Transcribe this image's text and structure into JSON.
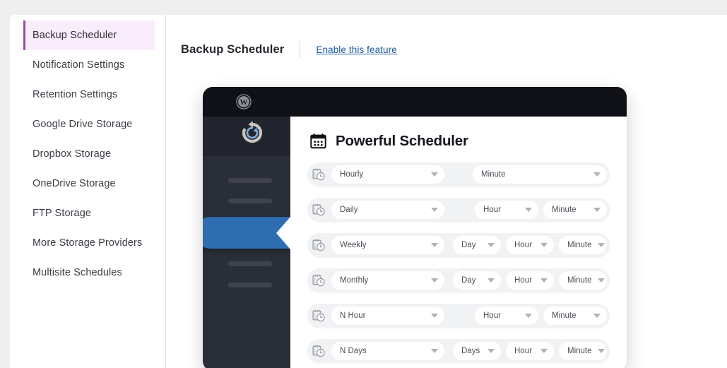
{
  "sidebar": {
    "items": [
      {
        "label": "Backup Scheduler",
        "active": true
      },
      {
        "label": "Notification Settings",
        "active": false
      },
      {
        "label": "Retention Settings",
        "active": false
      },
      {
        "label": "Google Drive Storage",
        "active": false
      },
      {
        "label": "Dropbox Storage",
        "active": false
      },
      {
        "label": "OneDrive Storage",
        "active": false
      },
      {
        "label": "FTP Storage",
        "active": false
      },
      {
        "label": "More Storage Providers",
        "active": false
      },
      {
        "label": "Multisite Schedules",
        "active": false
      }
    ]
  },
  "header": {
    "title": "Backup Scheduler",
    "enable_link": "Enable this feature"
  },
  "mockup": {
    "logo_icon": "wordpress-icon",
    "active_item_icon": "restore-refresh-icon",
    "title": "Powerful Scheduler",
    "title_icon": "calendar-icon",
    "row_icon": "calendar-clock-icon",
    "rows": [
      {
        "frequency": "Hourly",
        "slots": [
          "Minute"
        ]
      },
      {
        "frequency": "Daily",
        "slots": [
          "Hour",
          "Minute"
        ]
      },
      {
        "frequency": "Weekly",
        "slots": [
          "Day",
          "Hour",
          "Minute"
        ]
      },
      {
        "frequency": "Monthly",
        "slots": [
          "Day",
          "Hour",
          "Minute"
        ]
      },
      {
        "frequency": "N Hour",
        "slots": [
          "Hour",
          "Minute"
        ]
      },
      {
        "frequency": "N Days",
        "slots": [
          "Days",
          "Hour",
          "Minute"
        ]
      }
    ]
  },
  "colors": {
    "page_background": "#efefef",
    "panel": "#ffffff",
    "active_nav_background": "#f9ecfb",
    "active_nav_accent": "#9a4ba8",
    "link": "#1d5a9b",
    "mock_topbar": "#0f1116",
    "mock_sidebar": "#2a2e37",
    "mock_active_pill": "#2d6db0"
  }
}
